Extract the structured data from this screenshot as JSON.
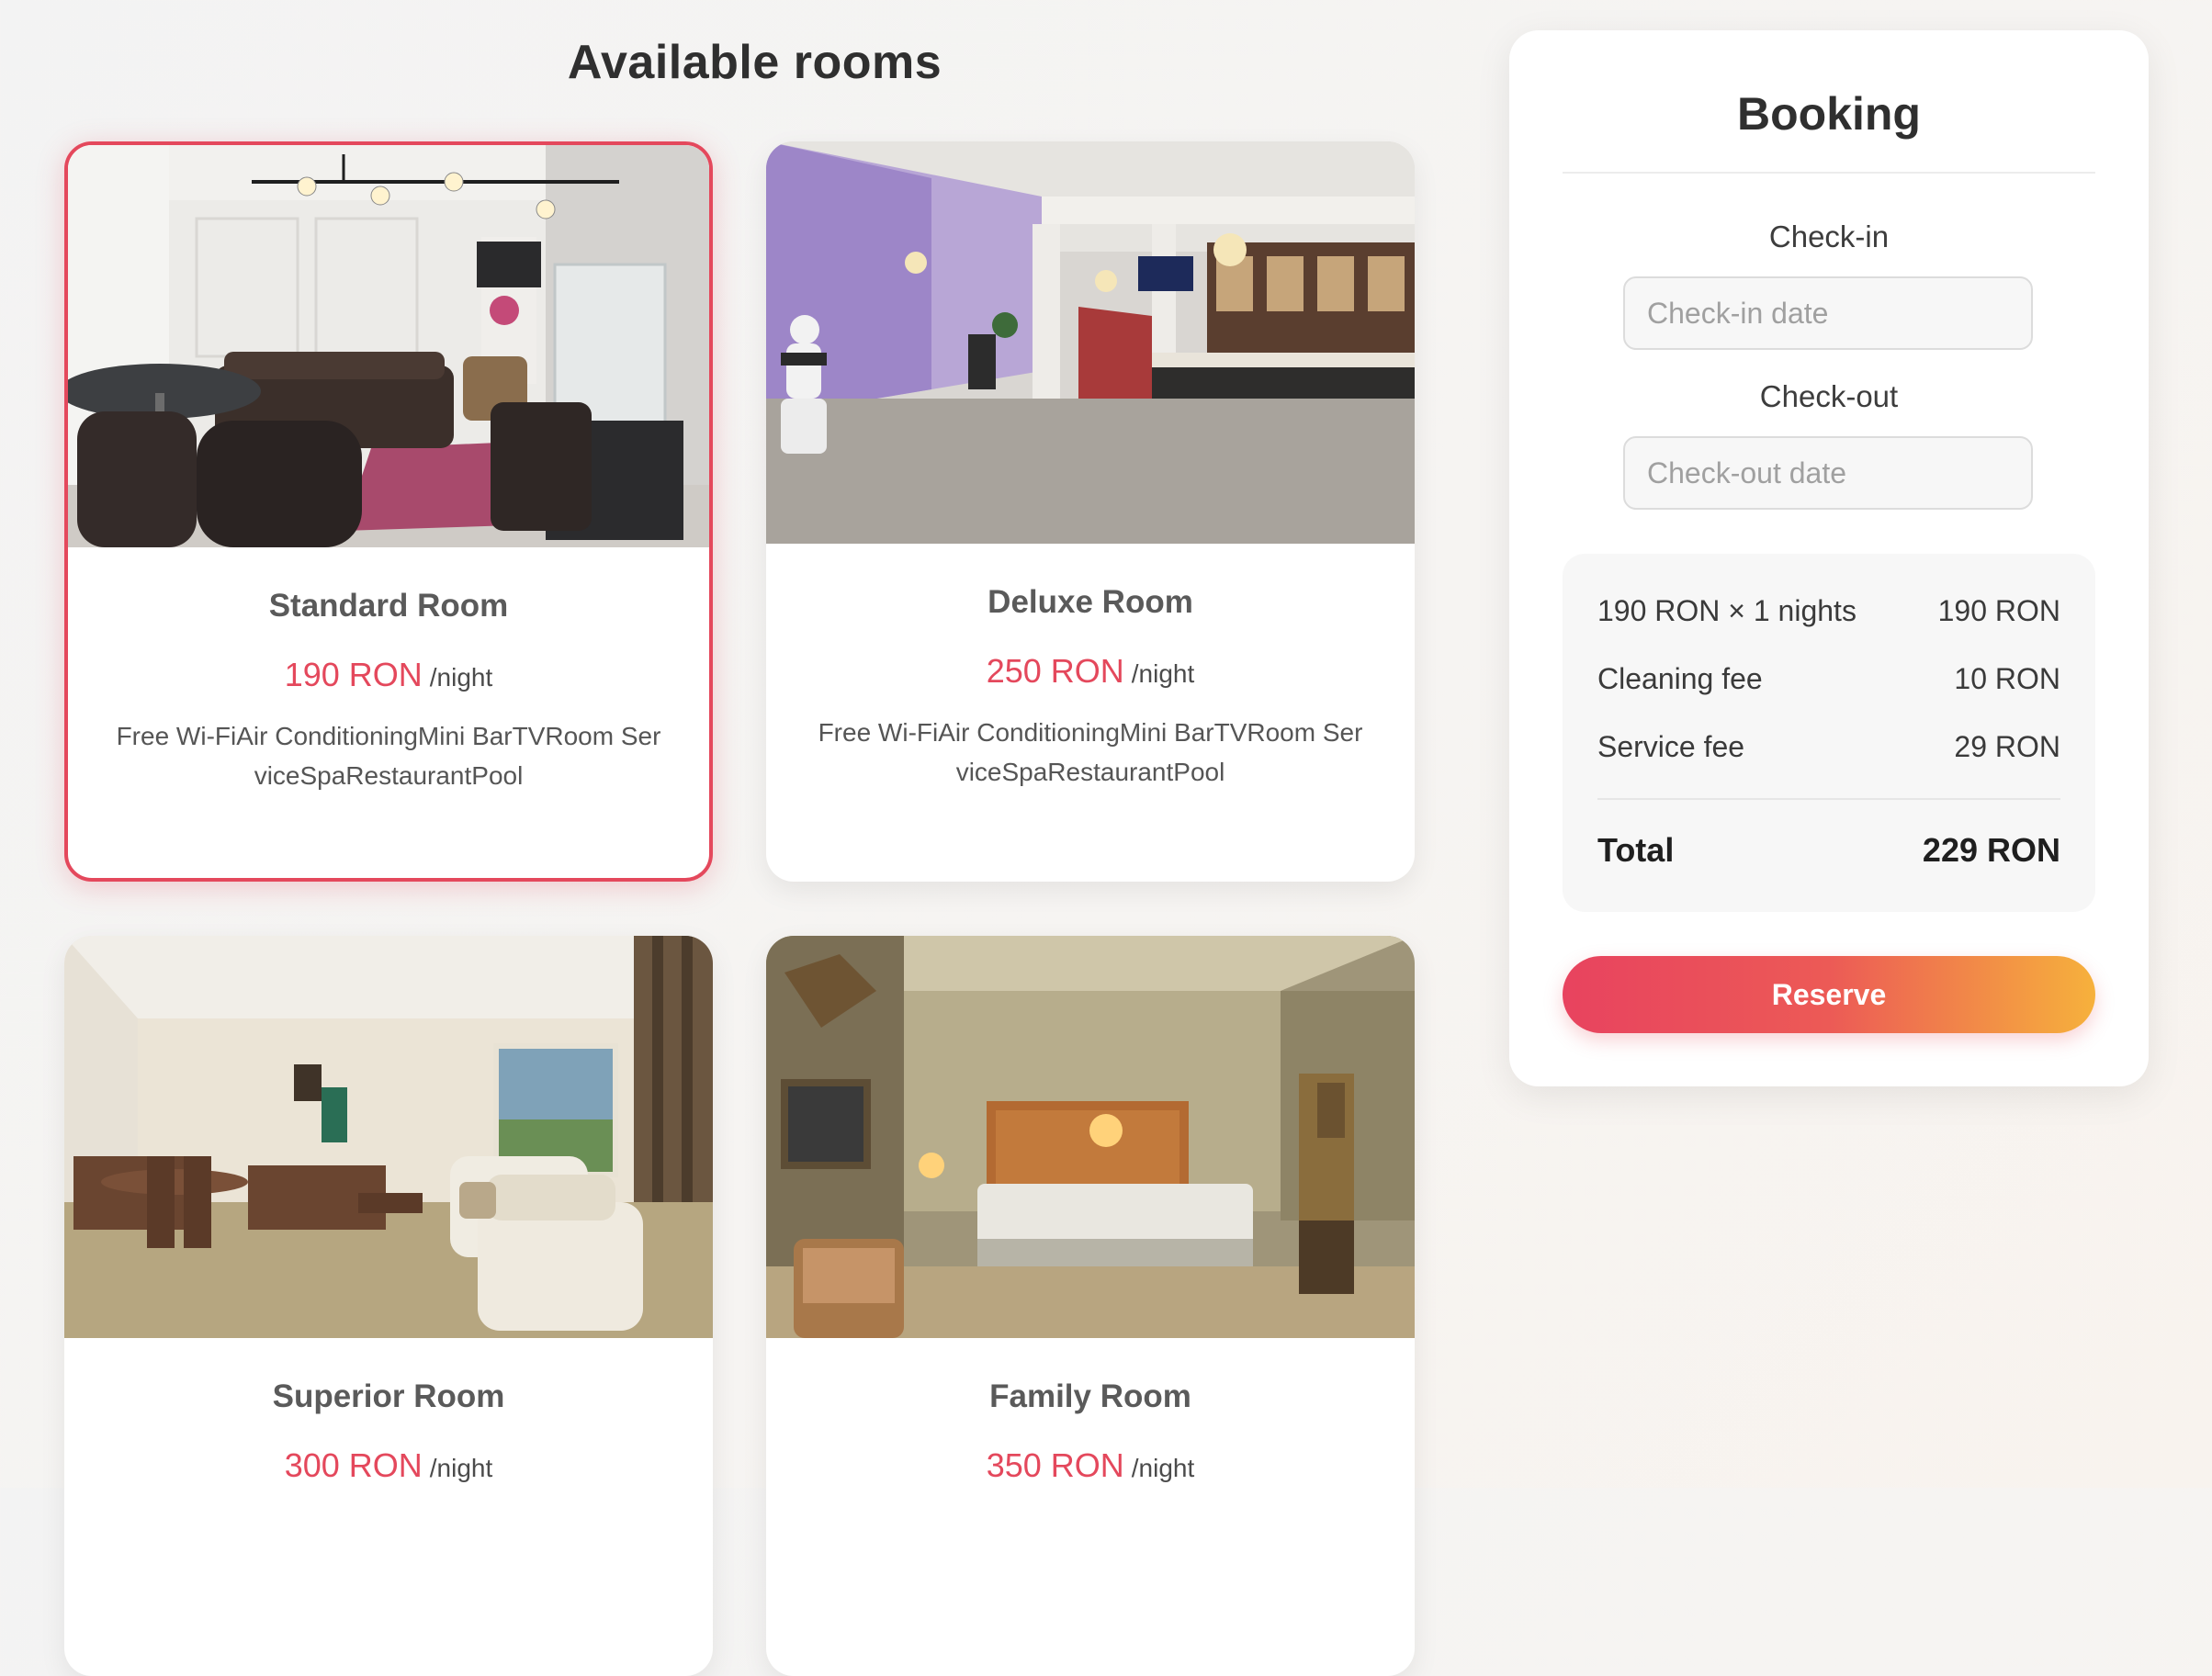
{
  "page": {
    "heading": "Available rooms"
  },
  "rooms": [
    {
      "name": "Standard Room",
      "price": "190 RON",
      "per_night": "/night",
      "amenities": "Free Wi-FiAir ConditioningMini BarTVRoom ServiceSpaRestaurantPool",
      "photo": "lounge-photo",
      "selected": true
    },
    {
      "name": "Deluxe Room",
      "price": "250 RON",
      "per_night": "/night",
      "amenities": "Free Wi-FiAir ConditioningMini BarTVRoom ServiceSpaRestaurantPool",
      "photo": "lobby-photo",
      "selected": false
    },
    {
      "name": "Superior Room",
      "price": "300 RON",
      "per_night": "/night",
      "photo": "living-room-photo",
      "selected": false
    },
    {
      "name": "Family Room",
      "price": "350 RON",
      "per_night": "/night",
      "photo": "bedroom-photo",
      "selected": false
    }
  ],
  "booking": {
    "title": "Booking",
    "checkin_label": "Check-in",
    "checkin_placeholder": "Check-in date",
    "checkin_value": "",
    "checkout_label": "Check-out",
    "checkout_placeholder": "Check-out date",
    "checkout_value": "",
    "summary": {
      "nights_label": "190 RON × 1 nights",
      "nights_amount": "190 RON",
      "cleaning_label": "Cleaning fee",
      "cleaning_amount": "10 RON",
      "service_label": "Service fee",
      "service_amount": "29 RON",
      "total_label": "Total",
      "total_amount": "229 RON"
    },
    "reserve_label": "Reserve"
  },
  "colors": {
    "accent": "#e4485c",
    "gradient_start": "#e8435f",
    "gradient_end": "#f6b13c"
  }
}
